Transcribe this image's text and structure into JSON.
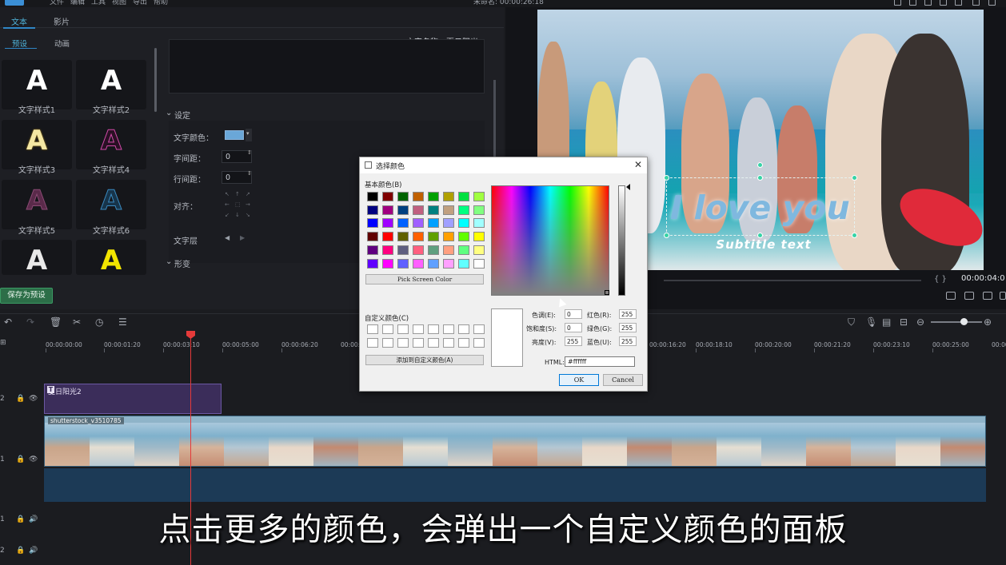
{
  "menubar": {
    "items": [
      "文件",
      "编辑",
      "工具",
      "视图",
      "导出",
      "帮助"
    ],
    "project": "未命名: 00:00:26:18"
  },
  "left_panel": {
    "tabs": [
      "文本",
      "影片"
    ],
    "sub_tabs": [
      "预设",
      "动画"
    ],
    "text_name_label": "文字名称：夏日阳光2",
    "styles": [
      {
        "label": "文字样式1",
        "glyph": "A",
        "color": "#ffffff"
      },
      {
        "label": "文字样式2",
        "glyph": "A",
        "color": "#ffffff"
      },
      {
        "label": "文字样式3",
        "glyph": "A",
        "color": "#f4e7a3"
      },
      {
        "label": "文字样式4",
        "glyph": "A",
        "color": "#2a1024"
      },
      {
        "label": "文字样式5",
        "glyph": "A",
        "color": "#5a2a4a"
      },
      {
        "label": "文字样式6",
        "glyph": "A",
        "color": "#17344a"
      },
      {
        "label": "",
        "glyph": "A",
        "color": "#e9e9e9"
      },
      {
        "label": "",
        "glyph": "A",
        "color": "#f2e400"
      }
    ],
    "settings_header": "设定",
    "text_color_label": "文字颜色：",
    "letter_spacing_label": "字间距：",
    "letter_spacing_value": "0",
    "line_spacing_label": "行间距：",
    "line_spacing_value": "0",
    "align_label": "对齐：",
    "layer_label": "文字层",
    "transform_header": "形变",
    "save_preset": "保存为预设",
    "accent_color": "#6aa7d8"
  },
  "preview": {
    "headline": "I love you",
    "subtitle": "Subtitle text",
    "timecode": "00:00:04:0",
    "brackets": "{ }"
  },
  "timeline": {
    "ruler": [
      "00:00:00:00",
      "00:00:01:20",
      "00:00:03:10",
      "00:00:05:00",
      "00:00:06:20",
      "00:00:08",
      "00:00:16:20",
      "00:00:18:10",
      "00:00:20:00",
      "00:00:21:20",
      "00:00:23:10",
      "00:00:25:00",
      "00:00:2"
    ],
    "tracks": [
      "2",
      "1",
      "1",
      "2"
    ],
    "text_clip": "夏日阳光2",
    "video_clip": "shutterstock_v3510785"
  },
  "caption": "点击更多的颜色，会弹出一个自定义颜色的面板",
  "dialog": {
    "title": "选择颜色",
    "basic_colors_label": "基本颜色(B)",
    "basic_colors": [
      "#000000",
      "#800000",
      "#006400",
      "#c06000",
      "#00a000",
      "#b0a000",
      "#00e040",
      "#a0ff40",
      "#000080",
      "#a00080",
      "#004080",
      "#c06080",
      "#008080",
      "#c0a080",
      "#00ff80",
      "#80ff80",
      "#0000ff",
      "#a000ff",
      "#0060ff",
      "#a060ff",
      "#00a0ff",
      "#a0a0ff",
      "#00ffff",
      "#a0ffff",
      "#600000",
      "#ff0000",
      "#606000",
      "#ff6000",
      "#60a000",
      "#ffa000",
      "#60ff00",
      "#ffff00",
      "#600080",
      "#ff0080",
      "#606080",
      "#ff6080",
      "#60a080",
      "#ffa080",
      "#60ff80",
      "#ffff80",
      "#6000ff",
      "#ff00ff",
      "#6060ff",
      "#ff60ff",
      "#60a0ff",
      "#ffa0ff",
      "#60ffff",
      "#ffffff"
    ],
    "pick_screen": "Pick Screen Color",
    "custom_colors_label": "自定义颜色(C)",
    "add_custom": "添加到自定义颜色(A)",
    "hue_label": "色调(E):",
    "hue": "0",
    "sat_label": "饱和度(S):",
    "sat": "0",
    "val_label": "亮度(V):",
    "val": "255",
    "red_label": "红色(R):",
    "red": "255",
    "green_label": "绿色(G):",
    "green": "255",
    "blue_label": "蓝色(U):",
    "blue": "255",
    "html_label": "HTML:",
    "html_value": "#ffffff",
    "ok": "OK",
    "cancel": "Cancel"
  }
}
